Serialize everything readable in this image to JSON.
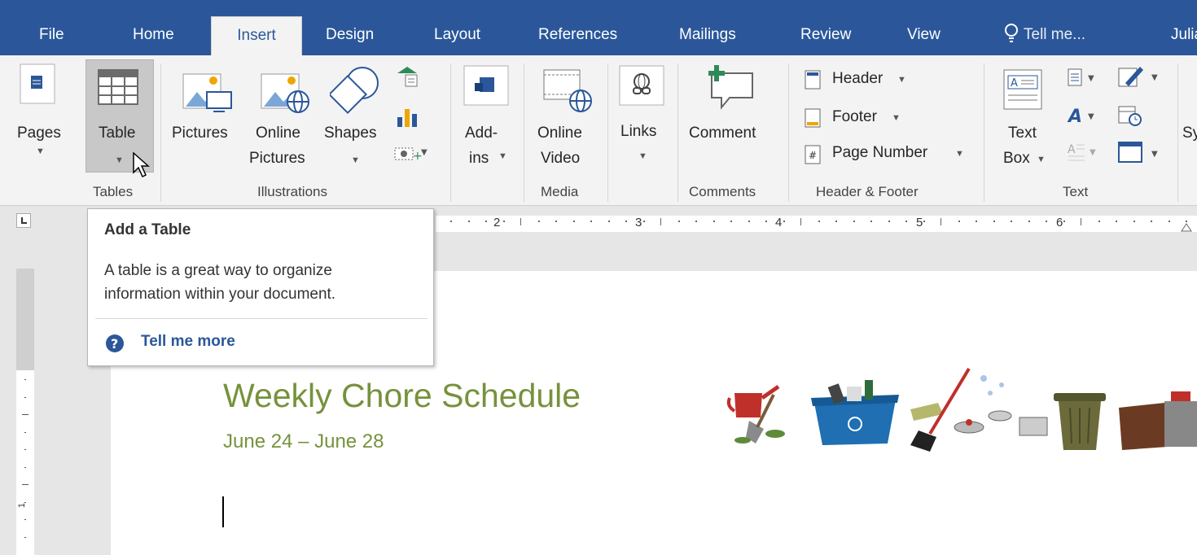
{
  "tabs": [
    {
      "label": "File"
    },
    {
      "label": "Home"
    },
    {
      "label": "Insert"
    },
    {
      "label": "Design"
    },
    {
      "label": "Layout"
    },
    {
      "label": "References"
    },
    {
      "label": "Mailings"
    },
    {
      "label": "Review"
    },
    {
      "label": "View"
    }
  ],
  "tell_me": "Tell me...",
  "user": "Julia",
  "ribbon": {
    "pages": "Pages",
    "table": "Table",
    "pictures": "Pictures",
    "online_pictures": [
      "Online",
      "Pictures"
    ],
    "shapes": "Shapes",
    "addins": [
      "Add-",
      "ins"
    ],
    "online_video": [
      "Online",
      "Video"
    ],
    "links": "Links",
    "comment": "Comment",
    "header": "Header",
    "footer": "Footer",
    "page_number": "Page Number",
    "text_box": [
      "Text",
      "Box"
    ],
    "symbols_partial": "Sy"
  },
  "groups": {
    "tables": "Tables",
    "illustrations": "Illustrations",
    "media": "Media",
    "comments": "Comments",
    "header_footer": "Header & Footer",
    "text": "Text"
  },
  "ruler_numbers": [
    "2",
    "3",
    "4",
    "5",
    "6"
  ],
  "tooltip": {
    "title": "Add a Table",
    "body": [
      "A table is a great way to organize",
      "information within your document."
    ],
    "link": "Tell me more"
  },
  "document": {
    "title": "Weekly Chore Schedule",
    "subtitle": "June 24 – June 28"
  },
  "colors": {
    "ribbon_blue": "#2b579a",
    "title_green": "#76923c"
  }
}
